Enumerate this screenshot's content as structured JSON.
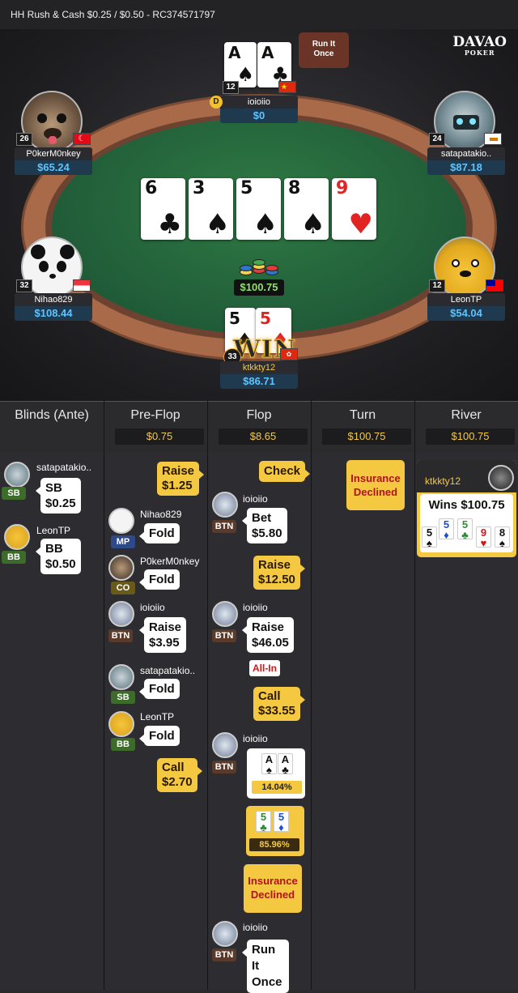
{
  "topbar": {
    "title": "HH  Rush & Cash $0.25 / $0.50  - RC374571797"
  },
  "table": {
    "logo_main": "DAVAO",
    "logo_sub": "POKER",
    "run_it_once": "Run It Once",
    "dealer_button": "D",
    "board": [
      {
        "rank": "6",
        "suit": "♣",
        "red": false
      },
      {
        "rank": "3",
        "suit": "♠",
        "red": false
      },
      {
        "rank": "5",
        "suit": "♠",
        "red": false
      },
      {
        "rank": "8",
        "suit": "♠",
        "red": false
      },
      {
        "rank": "9",
        "suit": "♥",
        "red": true
      }
    ],
    "pot": "$100.75",
    "win_label": "WIN",
    "seats": {
      "top": {
        "name": "ioioiio",
        "stack": "$0",
        "level": "12",
        "cards": [
          {
            "rank": "A",
            "suit": "♠"
          },
          {
            "rank": "A",
            "suit": "♣"
          }
        ]
      },
      "top_left": {
        "name": "P0kerM0nkey",
        "stack": "$65.24",
        "level": "26"
      },
      "top_right": {
        "name": "satapatakio..",
        "stack": "$87.18",
        "level": "24"
      },
      "mid_left": {
        "name": "Nihao829",
        "stack": "$108.44",
        "level": "32"
      },
      "mid_right": {
        "name": "LeonTP",
        "stack": "$54.04",
        "level": "12"
      },
      "hero": {
        "name": "ktkkty12",
        "stack": "$86.71",
        "level": "33",
        "cards": [
          {
            "rank": "5",
            "suit": "♠",
            "red": false
          },
          {
            "rank": "5",
            "suit": "♦",
            "red": true
          }
        ]
      }
    },
    "colors": {
      "felt": "#22603a",
      "rim": "#a86a48",
      "stack": "#5ec3ff",
      "pot": "#8fe06a",
      "action": "#f5c842"
    }
  },
  "columns": {
    "headers": [
      {
        "title": "Blinds (Ante)",
        "pot": ""
      },
      {
        "title": "Pre-Flop",
        "pot": "$0.75"
      },
      {
        "title": "Flop",
        "pot": "$8.65"
      },
      {
        "title": "Turn",
        "pot": "$100.75"
      },
      {
        "title": "River",
        "pot": "$100.75"
      }
    ]
  },
  "blinds": [
    {
      "name": "satapatakio..",
      "pos": "SB",
      "action": "SB",
      "amount": "$0.25"
    },
    {
      "name": "LeonTP",
      "pos": "BB",
      "action": "BB",
      "amount": "$0.50"
    }
  ],
  "preflop": {
    "hero_raise": {
      "action": "Raise",
      "amount": "$1.25"
    },
    "rows": [
      {
        "name": "Nihao829",
        "pos": "MP",
        "action": "Fold"
      },
      {
        "name": "P0kerM0nkey",
        "pos": "CO",
        "action": "Fold"
      },
      {
        "name": "ioioiio",
        "pos": "BTN",
        "action": "Raise",
        "amount": "$3.95"
      },
      {
        "name": "satapatakio..",
        "pos": "SB",
        "action": "Fold"
      },
      {
        "name": "LeonTP",
        "pos": "BB",
        "action": "Fold"
      }
    ],
    "hero_call": {
      "action": "Call",
      "amount": "$2.70"
    }
  },
  "flop": {
    "hero_check": "Check",
    "bet": {
      "name": "ioioiio",
      "pos": "BTN",
      "action": "Bet",
      "amount": "$5.80"
    },
    "hero_raise": {
      "action": "Raise",
      "amount": "$12.50"
    },
    "raise2": {
      "name": "ioioiio",
      "pos": "BTN",
      "action": "Raise",
      "amount": "$46.05",
      "tag": "All-In"
    },
    "hero_call": {
      "action": "Call",
      "amount": "$33.55"
    },
    "villain_show": {
      "name": "ioioiio",
      "pos": "BTN",
      "cards": [
        {
          "rank": "A",
          "suit": "♠"
        },
        {
          "rank": "A",
          "suit": "♣"
        }
      ],
      "equity": "14.04%"
    },
    "hero_show": {
      "cards": [
        {
          "rank": "5",
          "suit": "♣"
        },
        {
          "rank": "5",
          "suit": "♦"
        }
      ],
      "equity": "85.96%"
    },
    "hero_insurance": "Insurance Declined",
    "run": {
      "name": "ioioiio",
      "pos": "BTN",
      "action": "Run It Once"
    }
  },
  "turn": {
    "insurance": "Insurance Declined"
  },
  "river": {
    "winner": "ktkkty12",
    "wins": "Wins $100.75",
    "cards": [
      {
        "rank": "5",
        "suit": "♠"
      },
      {
        "rank": "5",
        "suit": "♦"
      },
      {
        "rank": "5",
        "suit": "♣"
      },
      {
        "rank": "9",
        "suit": "♥"
      },
      {
        "rank": "8",
        "suit": "♠"
      }
    ]
  }
}
